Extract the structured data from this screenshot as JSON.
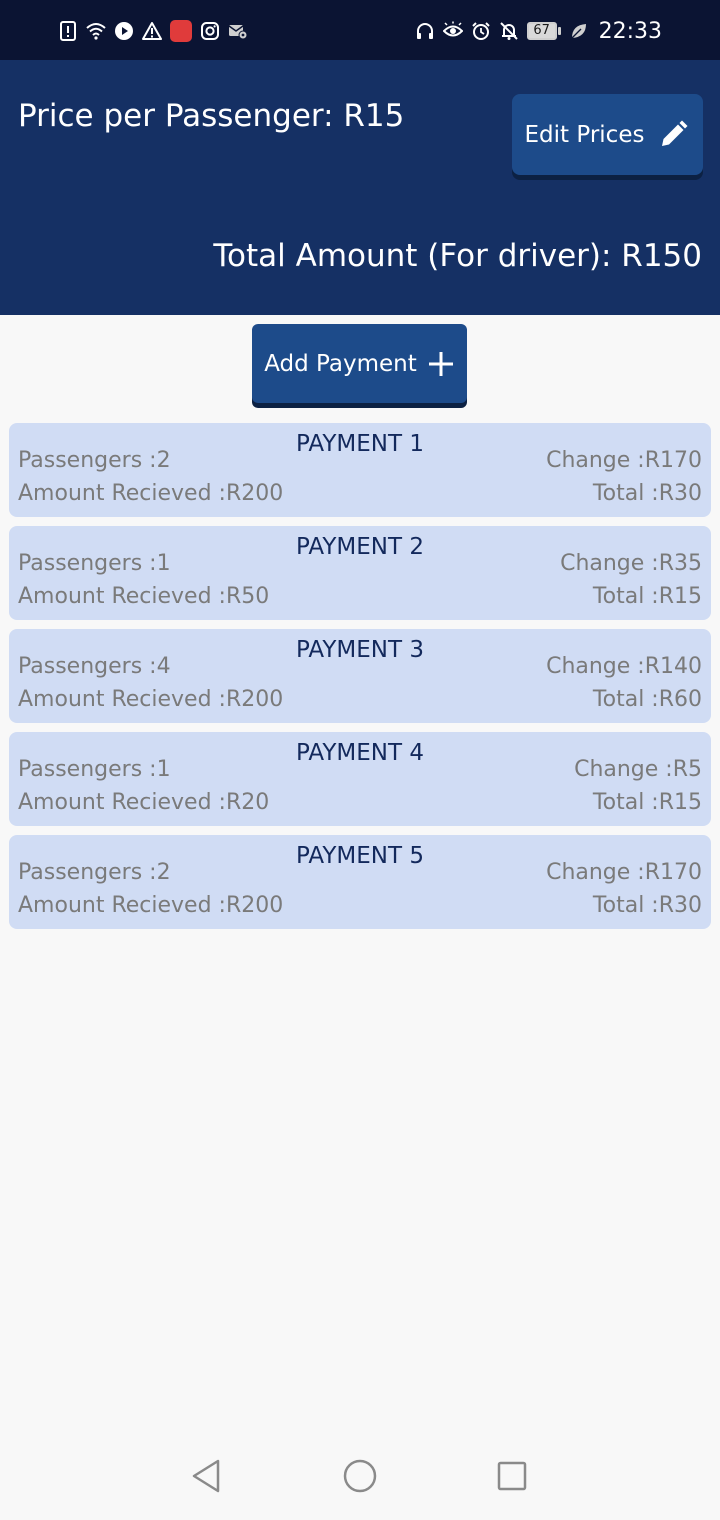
{
  "status_bar": {
    "time": "22:33",
    "battery": "67",
    "left_icons": [
      "alert-file-icon",
      "wifi-icon",
      "play-icon",
      "warning-icon",
      "huawei-store-icon",
      "instagram-icon",
      "mail-settings-icon"
    ],
    "right_icons": [
      "headset-icon",
      "eye-icon",
      "alarm-icon",
      "mute-bell-icon",
      "battery-icon",
      "leaf-icon"
    ]
  },
  "header": {
    "price_per_passenger": "Price per Passenger: R15",
    "edit_prices_label": "Edit Prices",
    "total_amount": "Total Amount (For driver): R150"
  },
  "add_payment": {
    "label": "Add Payment"
  },
  "payments": [
    {
      "title": "PAYMENT 1",
      "passengers": "Passengers :2",
      "amount_received": "Amount Recieved :R200",
      "change": "Change :R170",
      "total": "Total :R30"
    },
    {
      "title": "PAYMENT 2",
      "passengers": "Passengers :1",
      "amount_received": "Amount Recieved :R50",
      "change": "Change :R35",
      "total": "Total :R15"
    },
    {
      "title": "PAYMENT 3",
      "passengers": "Passengers :4",
      "amount_received": "Amount Recieved :R200",
      "change": "Change :R140",
      "total": "Total :R60"
    },
    {
      "title": "PAYMENT 4",
      "passengers": "Passengers :1",
      "amount_received": "Amount Recieved :R20",
      "change": "Change :R5",
      "total": "Total :R15"
    },
    {
      "title": "PAYMENT 5",
      "passengers": "Passengers :2",
      "amount_received": "Amount Recieved :R200",
      "change": "Change :R170",
      "total": "Total :R30"
    }
  ],
  "colors": {
    "status_bar_bg": "#0b1433",
    "header_bg": "#153064",
    "button_bg": "#1d4b8a",
    "card_bg": "#d0dcf4",
    "card_title": "#13295c",
    "card_text": "#7a7a7a",
    "page_bg": "#f8f8f8"
  }
}
